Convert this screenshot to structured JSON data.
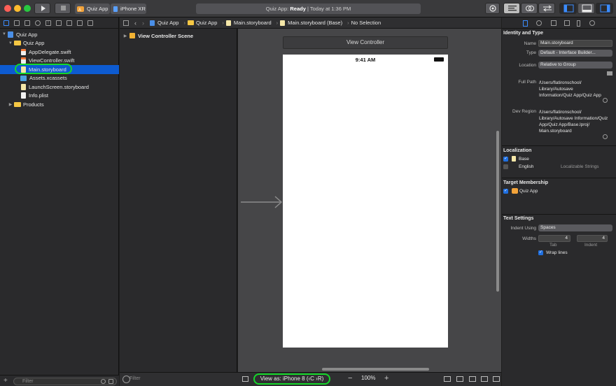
{
  "toolbar": {
    "scheme_target": "Quiz App",
    "scheme_device": "iPhone XR",
    "status_app": "Quiz App: ",
    "status_state": "Ready",
    "status_time": " | Today at 1:36 PM"
  },
  "navigator": {
    "items": [
      {
        "label": "Quiz App",
        "kind": "project"
      },
      {
        "label": "Quiz App",
        "kind": "folder"
      },
      {
        "label": "AppDelegate.swift",
        "kind": "swift"
      },
      {
        "label": "ViewController.swift",
        "kind": "swift"
      },
      {
        "label": "Main.storyboard",
        "kind": "storyboard",
        "selected": true
      },
      {
        "label": "Assets.xcassets",
        "kind": "assets"
      },
      {
        "label": "LaunchScreen.storyboard",
        "kind": "storyboard"
      },
      {
        "label": "Info.plist",
        "kind": "plist"
      },
      {
        "label": "Products",
        "kind": "folder"
      }
    ],
    "filter_placeholder": "Filter"
  },
  "jumpbar": {
    "crumbs": [
      "Quiz App",
      "Quiz App",
      "Main.storyboard",
      "Main.storyboard (Base)",
      "No Selection"
    ]
  },
  "outline": {
    "scene": "View Controller Scene",
    "filter_placeholder": "Filter"
  },
  "canvas": {
    "vc_title": "View Controller",
    "time": "9:41 AM",
    "view_as": "View as: iPhone 8 (‹C ›R)",
    "zoom": "100%"
  },
  "inspector": {
    "identity_title": "Identity and Type",
    "name_label": "Name",
    "name_value": "Main.storyboard",
    "type_label": "Type",
    "type_value": "Default - Interface Builder...",
    "location_label": "Location",
    "location_value": "Relative to Group",
    "fullpath_label": "Full Path",
    "fullpath_value": "/Users/flatironschool/ Library/Autosave Information/Quiz App/Quiz App",
    "devregion_label": "Dev Region",
    "devregion_value": "/Users/flatironschool/ Library/Autosave Information/Quiz App/Quiz App/Base.lproj/ Main.storyboard",
    "localization_title": "Localization",
    "loc_base": "Base",
    "loc_english": "English",
    "loc_strings": "Localizable Strings",
    "target_title": "Target Membership",
    "target_app": "Quiz App",
    "text_title": "Text Settings",
    "indent_label": "Indent Using",
    "indent_value": "Spaces",
    "widths_label": "Widths",
    "tab_value": "4",
    "indent_width_value": "4",
    "tab_caption": "Tab",
    "indent_caption": "Indent",
    "wrap_label": "Wrap lines"
  }
}
